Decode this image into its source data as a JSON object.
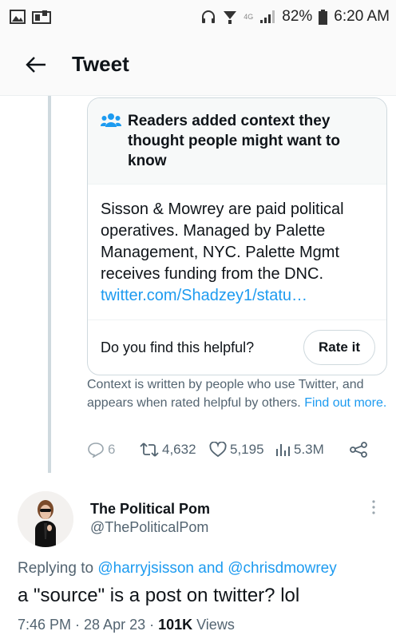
{
  "status_bar": {
    "network_label": "4G",
    "battery": "82%",
    "time": "6:20 AM"
  },
  "header": {
    "title": "Tweet"
  },
  "community_note": {
    "heading": "Readers added context they thought people might want to know",
    "body": "Sisson & Mowrey are paid political operatives. Managed by Palette Management, NYC. Palette Mgmt receives funding from the DNC.",
    "link": "twitter.com/Shadzey1/statu…",
    "helpful_question": "Do you find this helpful?",
    "rate_button": "Rate it"
  },
  "context_info": {
    "text": "Context is written by people who use Twitter, and appears when rated helpful by others.",
    "link": "Find out more."
  },
  "tweet_actions": {
    "replies": "6",
    "retweets": "4,632",
    "likes": "5,195",
    "views": "5.3M"
  },
  "reply_tweet": {
    "name": "The Political Pom",
    "handle": "@ThePoliticalPom",
    "replying_prefix": "Replying to",
    "replying_to": "@harryjsisson and @chrisdmowrey",
    "text": "a \"source\" is a post on twitter? lol",
    "timestamp": "7:46 PM · 28 Apr 23 · ",
    "views_count": "101K",
    "views_label": " Views"
  },
  "colors": {
    "accent": "#1d9bf0",
    "secondary_text": "#536471",
    "border": "#cfd9de"
  }
}
